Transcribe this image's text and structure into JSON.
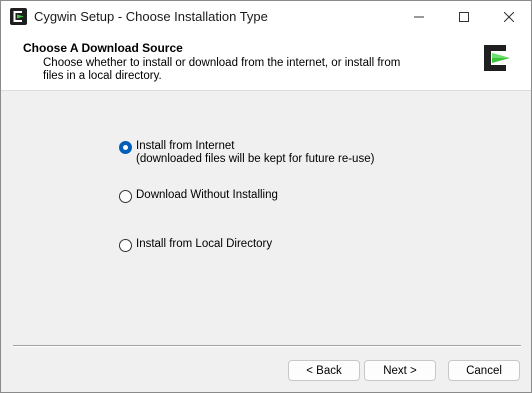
{
  "window": {
    "title": "Cygwin Setup - Choose Installation Type",
    "controls": {
      "minimize": "—",
      "maximize": "☐",
      "close": "✕"
    }
  },
  "header": {
    "title": "Choose A Download Source",
    "description": "Choose whether to install or download from the internet, or install from files in a local directory."
  },
  "options": [
    {
      "label": "Install from Internet",
      "sublabel": "(downloaded files will be kept for future re-use)",
      "selected": true
    },
    {
      "label": "Download Without Installing",
      "selected": false
    },
    {
      "label": "Install from Local Directory",
      "selected": false
    }
  ],
  "buttons": {
    "back": "< Back",
    "next": "Next >",
    "cancel": "Cancel"
  },
  "colors": {
    "accent": "#005fb8",
    "logo_green": "#3cc43c",
    "logo_dark": "#1f1f1f"
  }
}
